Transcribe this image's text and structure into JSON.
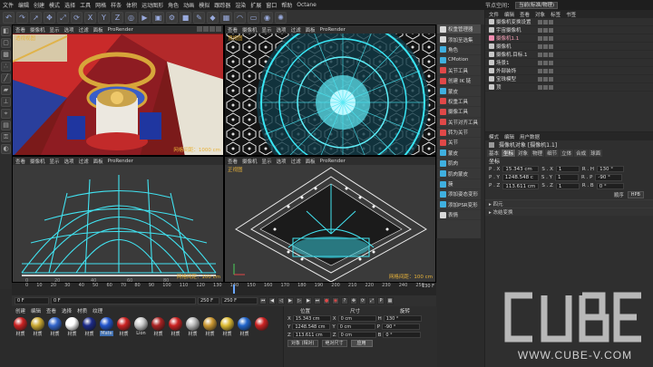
{
  "menubar": {
    "items": [
      "文件",
      "编辑",
      "创建",
      "模式",
      "选择",
      "工具",
      "网格",
      "样条",
      "体积",
      "运动图形",
      "角色",
      "动画",
      "模拟",
      "跟踪器",
      "渲染",
      "扩展",
      "窗口",
      "帮助",
      "Octane"
    ],
    "layout_label": "节点空间：",
    "layout_value": "当前(标准/物理)"
  },
  "viewport_menu": [
    "查看",
    "摄像机",
    "显示",
    "选项",
    "过滤",
    "面板",
    "ProRender"
  ],
  "viewports": [
    {
      "label": "透视视图",
      "grid": "网格间距：1000 cm"
    },
    {
      "label": "顶视图",
      "grid": ""
    },
    {
      "label": "",
      "grid": "网格间距：100 cm"
    },
    {
      "label": "正视图",
      "grid": "网格间距：100 cm"
    }
  ],
  "context_menu": {
    "items": [
      {
        "label": "权重管理器",
        "color": "#d9d9d9"
      },
      {
        "label": "添加至选集",
        "color": "#d9d9d9"
      },
      {
        "label": "角色",
        "color": "#3fb0e0"
      },
      {
        "label": "CMotion",
        "color": "#3fb0e0"
      },
      {
        "label": "关节工具",
        "color": "#e04848"
      },
      {
        "label": "创建 IK 链",
        "color": "#e04848"
      },
      {
        "label": "蒙皮",
        "color": "#3fb0e0"
      },
      {
        "label": "权重工具",
        "color": "#e04848"
      },
      {
        "label": "摄像工具",
        "color": "#e04848"
      },
      {
        "label": "关节对齐工具",
        "color": "#e04848"
      },
      {
        "label": "转为关节",
        "color": "#e04848"
      },
      {
        "label": "关节",
        "color": "#e04848"
      },
      {
        "label": "蒙皮",
        "color": "#3fb0e0"
      },
      {
        "label": "肌肉",
        "color": "#3fb0e0"
      },
      {
        "label": "肌肉蒙皮",
        "color": "#3fb0e0"
      },
      {
        "label": "簇",
        "color": "#3fb0e0"
      },
      {
        "label": "添加姿态变形",
        "color": "#3fb0e0"
      },
      {
        "label": "添加PSR变形",
        "color": "#3fb0e0"
      },
      {
        "label": "表情",
        "color": "#d9d9d9"
      }
    ]
  },
  "object_panel": {
    "tabs": [
      "文件",
      "编辑",
      "查看",
      "对象",
      "标签",
      "书签"
    ],
    "objects": [
      {
        "name": "摄像机变换设置",
        "color": "#c8c8c8",
        "selected": false
      },
      {
        "name": "宇宙摄像机",
        "color": "#c8c8c8",
        "selected": false
      },
      {
        "name": "摄像机1.1",
        "color": "#f28cb0",
        "selected": true
      },
      {
        "name": "摄像机",
        "color": "#c8c8c8",
        "selected": false
      },
      {
        "name": "摄像机.目标.1",
        "color": "#c8c8c8",
        "selected": false
      },
      {
        "name": "场景1",
        "color": "#c8c8c8",
        "selected": false
      },
      {
        "name": "外部装饰",
        "color": "#c8c8c8",
        "selected": false
      },
      {
        "name": "宝珠模型",
        "color": "#c8c8c8",
        "selected": false
      },
      {
        "name": "顶",
        "color": "#c8c8c8",
        "selected": false
      }
    ]
  },
  "attr_panel": {
    "menu": [
      "模式",
      "编辑",
      "用户数据"
    ],
    "title": "摄像机对象 [摄像机1.1]",
    "tabs": [
      "基本",
      "坐标",
      "对象",
      "物理",
      "细节",
      "立体",
      "合成",
      "球面"
    ],
    "active_tab": "坐标",
    "section": "坐标",
    "rows": [
      {
        "p": "P . X",
        "pv": "15.343 cm",
        "s": "S . X",
        "sv": "1",
        "r": "R . H",
        "rv": "130 °"
      },
      {
        "p": "P . Y",
        "pv": "1248.548 c",
        "s": "S . Y",
        "sv": "1",
        "r": "R . P",
        "rv": "-90 °"
      },
      {
        "p": "P . Z",
        "pv": "113.611 cm",
        "s": "S . Z",
        "sv": "1",
        "r": "R . B",
        "rv": "0 °"
      }
    ],
    "order_label": "顺序",
    "order_value": "HPB",
    "collapse_1": "▸ 四元",
    "collapse_2": "▸ 冻结变换"
  },
  "timeline": {
    "ticks": [
      "0",
      "10",
      "20",
      "30",
      "40",
      "50",
      "60",
      "70",
      "80",
      "90",
      "100",
      "110",
      "120",
      "130",
      "140",
      "150",
      "160",
      "170",
      "180",
      "190",
      "200",
      "210",
      "220",
      "230",
      "240",
      "250"
    ],
    "current_frame": "130",
    "end_frame": "130 F",
    "progress": 0.52,
    "start_field": "0 F",
    "field2": "0 F",
    "field3": "250 F",
    "field4": "250 F"
  },
  "materials": {
    "menu": [
      "创建",
      "编辑",
      "查看",
      "选择",
      "材质",
      "纹理"
    ],
    "items": [
      {
        "label": "材质",
        "color": "#cc2222"
      },
      {
        "label": "材质",
        "color": "#ccaa33"
      },
      {
        "label": "材质",
        "color": "#3366cc"
      },
      {
        "label": "材质",
        "color": "#ffffff"
      },
      {
        "label": "材质",
        "color": "#1c2a88"
      },
      {
        "label": "Mate",
        "color": "#2255cc"
      },
      {
        "label": "材质",
        "color": "#cc2222"
      },
      {
        "label": "Lion",
        "color": "#cccccc"
      },
      {
        "label": "材质",
        "color": "#aa2222"
      },
      {
        "label": "材质",
        "color": "#cc2222"
      },
      {
        "label": "材质",
        "color": "#bbbbbb"
      },
      {
        "label": "材质",
        "color": "#cc9933"
      },
      {
        "label": "材质",
        "color": "#ddbb33"
      },
      {
        "label": "材质",
        "color": "#2266cc"
      },
      {
        "label": "",
        "color": "#cc2222"
      }
    ]
  },
  "transform": {
    "head_pos": "位置",
    "head_size": "尺寸",
    "head_rot": "旋转",
    "rows": [
      {
        "a": "X",
        "av": "15.343 cm",
        "b": "X",
        "bv": "0 cm",
        "c": "H",
        "cv": "130 °"
      },
      {
        "a": "Y",
        "av": "1248.548 cm",
        "b": "Y",
        "bv": "0 cm",
        "c": "P",
        "cv": "-90 °"
      },
      {
        "a": "Z",
        "av": "113.611 cm",
        "b": "Z",
        "bv": "0 cm",
        "c": "B",
        "cv": "0 °"
      }
    ],
    "mode_1": "对象 (相对)",
    "mode_2": "绝对尺寸",
    "apply": "应用"
  },
  "watermark": {
    "logo": "CUBE",
    "url": "WWW.CUBE-V.COM"
  }
}
